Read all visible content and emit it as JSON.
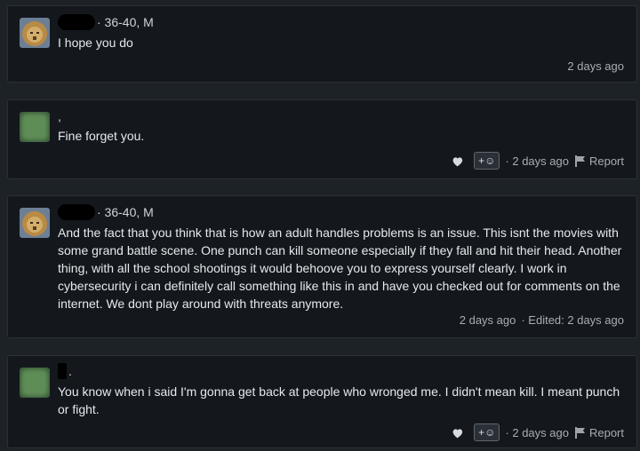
{
  "comments": [
    {
      "meta_suffix": "· 36-40, M",
      "text": "I hope you do",
      "timestamp": "2 days ago",
      "avatar_type": "lion"
    },
    {
      "meta_suffix": ",",
      "text": "Fine forget you.",
      "timestamp": "· 2 days ago",
      "avatar_type": "blurred-green",
      "react_label": "+☺",
      "report_label": "Report"
    },
    {
      "meta_suffix": "· 36-40, M",
      "text": "And the fact that you think that is how an adult handles problems is an issue. This isnt the movies with some grand battle scene. One punch can kill someone especially if they fall and hit their head. Another thing, with all the school shootings it would behoove you to express yourself clearly. I work in cybersecurity i can definitely call something like this in and have you checked out for comments on the internet. We dont play around with threats anymore.",
      "timestamp": "2 days ago",
      "edited": "· Edited: 2 days ago",
      "avatar_type": "lion"
    },
    {
      "meta_suffix": ".",
      "text": "You know when i said I'm gonna get back at people who wronged me. I didn't mean kill. I meant punch or fight.",
      "timestamp": "· 2 days ago",
      "avatar_type": "blurred-green",
      "react_label": "+☺",
      "report_label": "Report"
    }
  ],
  "icons": {
    "like": "heart-icon",
    "report": "flag-icon"
  }
}
